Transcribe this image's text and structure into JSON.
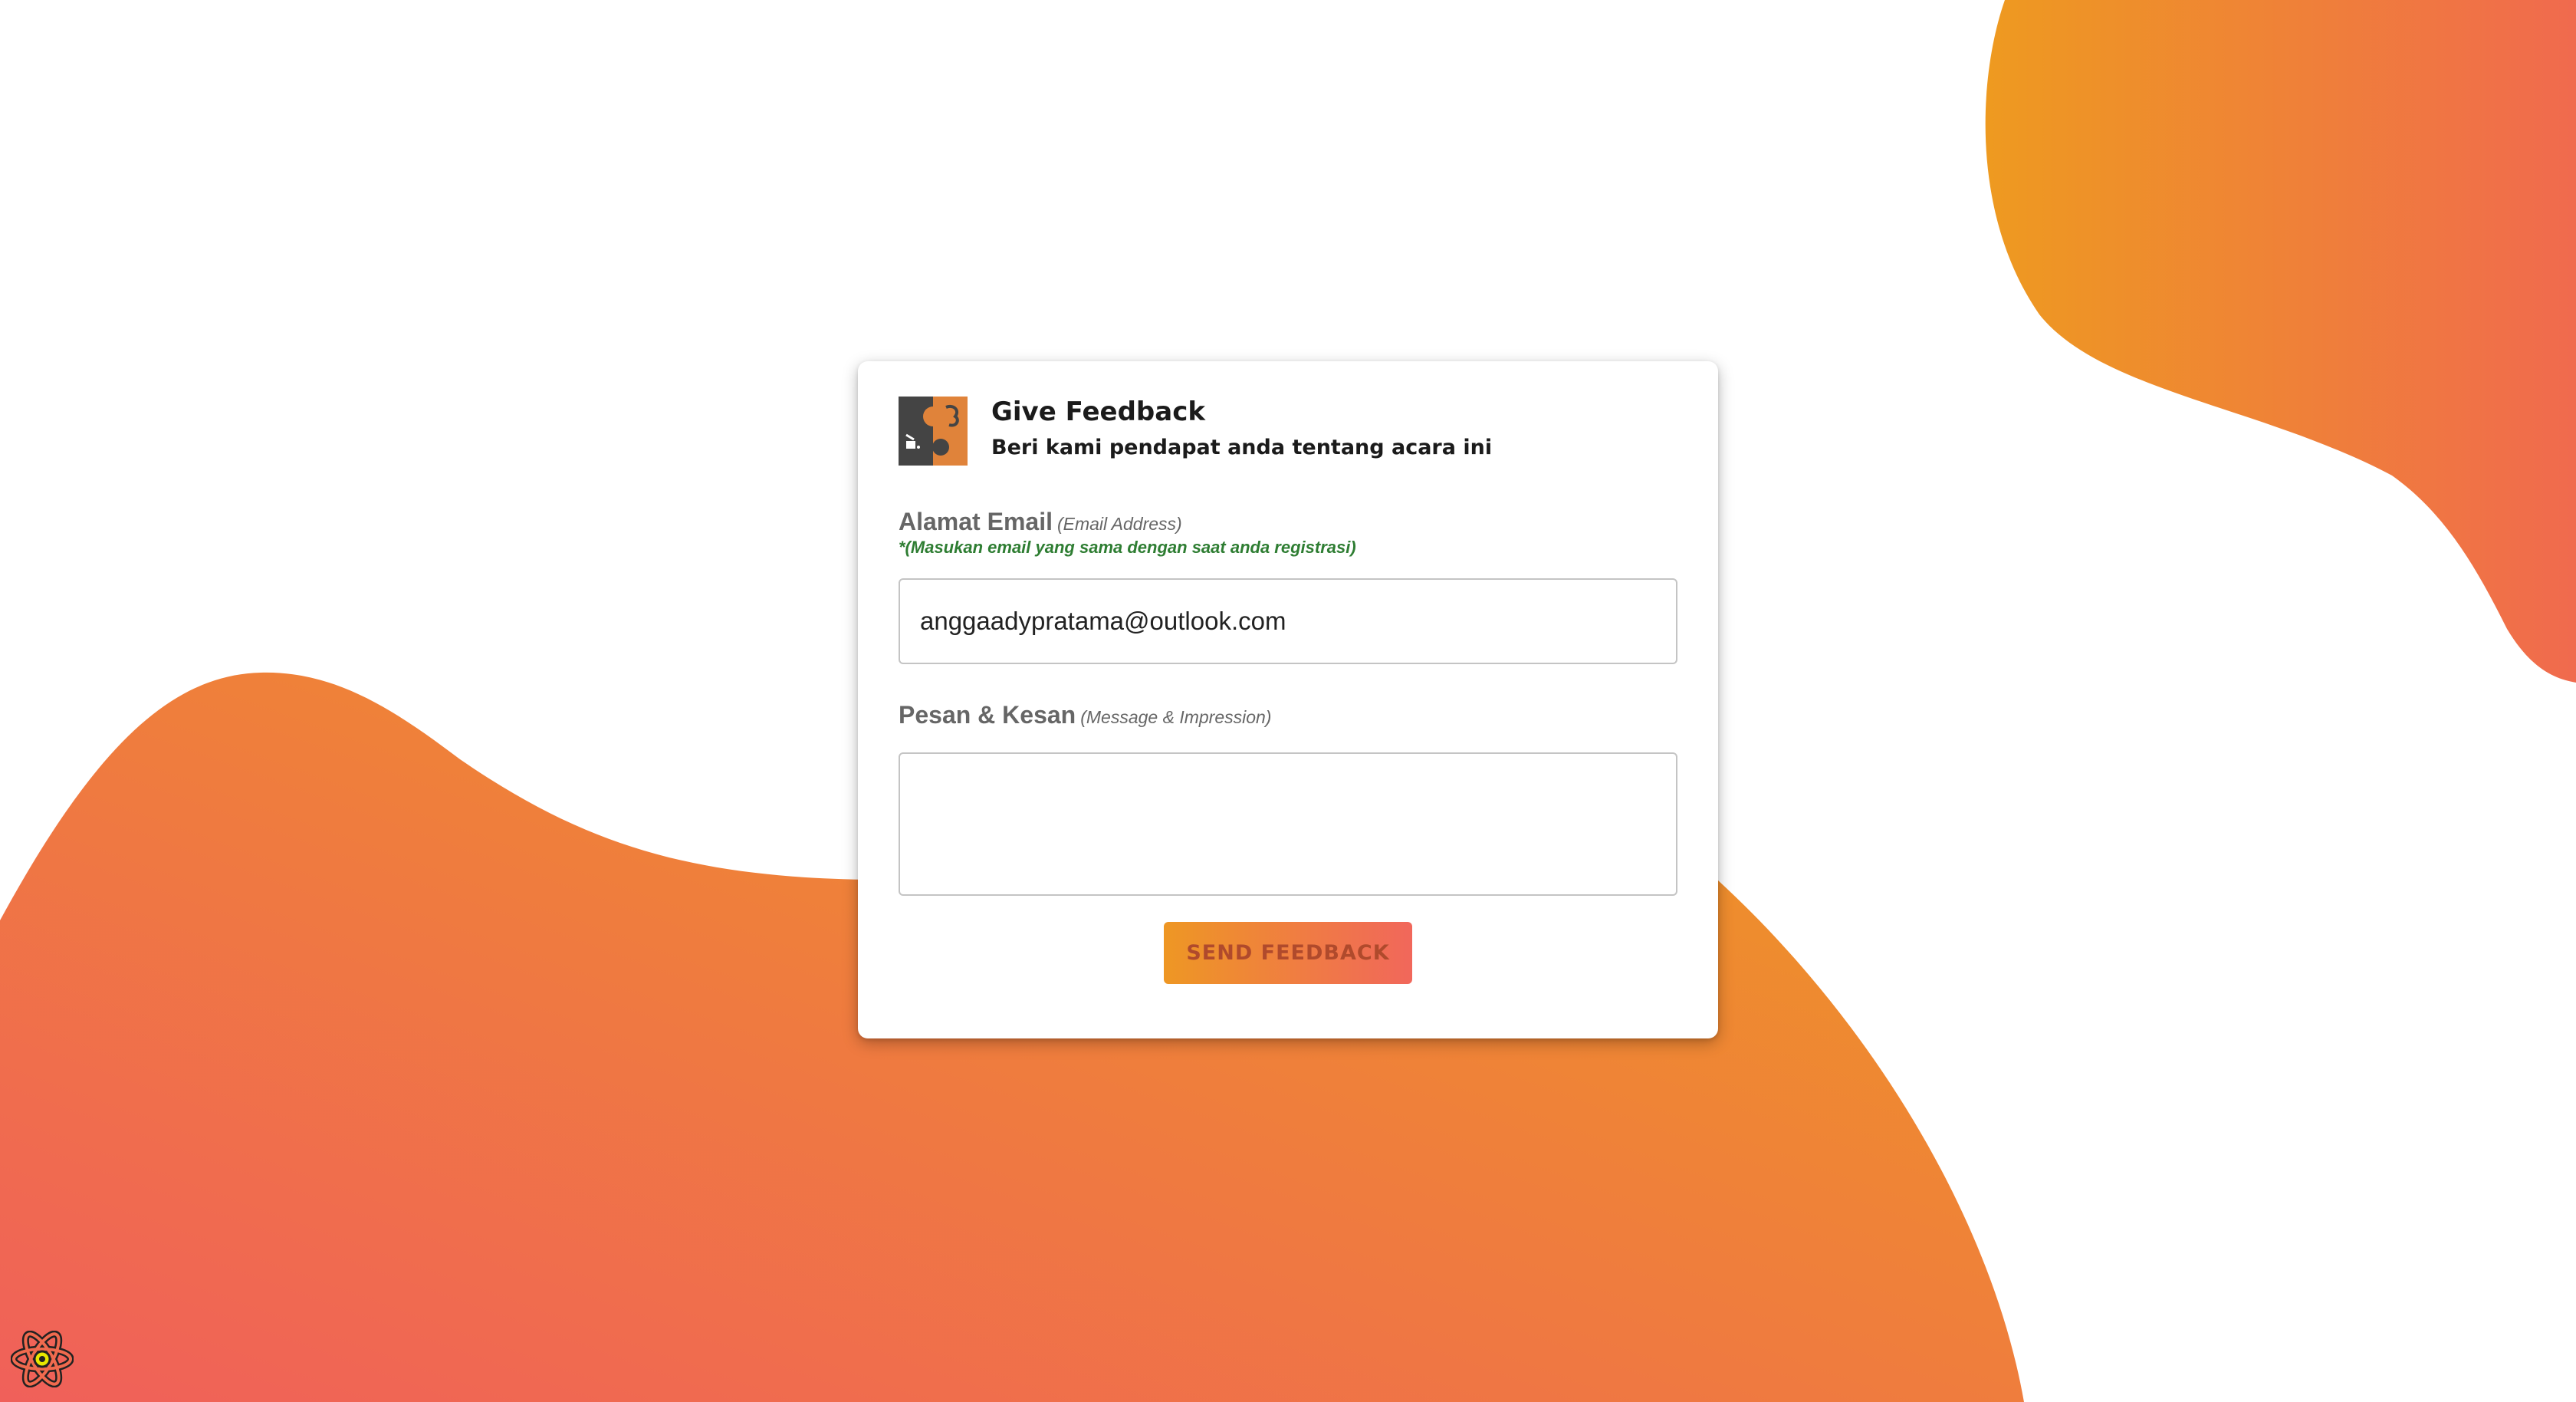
{
  "card": {
    "title": "Give Feedback",
    "subtitle": "Beri kami pendapat anda tentang acara ini"
  },
  "email": {
    "label": "Alamat Email",
    "hint": "(Email Address)",
    "note": "*(Masukan email yang sama dengan saat anda registrasi)",
    "value": "anggaadypratama@outlook.com",
    "placeholder": ""
  },
  "message": {
    "label": "Pesan & Kesan",
    "hint": "(Message & Impression)",
    "value": ""
  },
  "actions": {
    "send_label": "SEND FEEDBACK"
  },
  "icons": {
    "logo": "event-logo-icon",
    "corner": "react-icon"
  },
  "colors": {
    "gradient_start": "#ee9724",
    "gradient_end": "#f1675b",
    "note": "#2e7d32",
    "label": "#666666",
    "title": "#1b1b1b"
  }
}
